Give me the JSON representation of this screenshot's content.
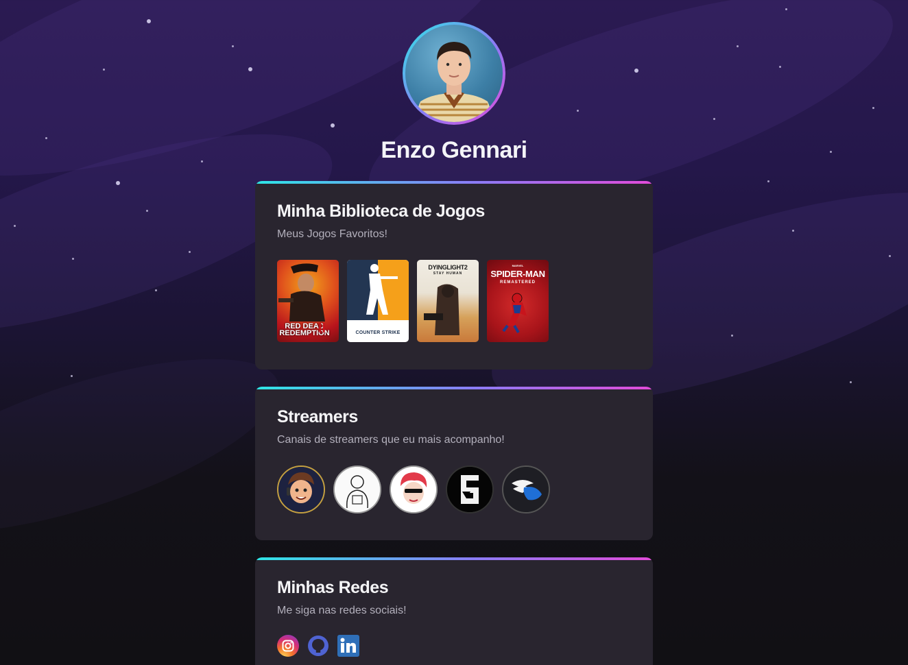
{
  "profile": {
    "name": "Enzo Gennari"
  },
  "games_section": {
    "title": "Minha Biblioteca de Jogos",
    "subtitle": "Meus Jogos Favoritos!",
    "games": [
      {
        "name": "RED DEAD REDEMPTION II",
        "cover_text": "RED DEAD\nREDEMPTION",
        "mark": "II"
      },
      {
        "name": "COUNTER STRIKE",
        "cover_text_a": "COUNTER",
        "cover_text_b": "STRIKE"
      },
      {
        "name": "DYING LIGHT 2",
        "cover_text": "DYINGLIGHT2",
        "cover_sub": "STAY HUMAN"
      },
      {
        "name": "SPIDER-MAN REMASTERED",
        "cover_text_small": "MARVEL",
        "cover_text": "SPIDER-MAN",
        "cover_sub": "REMASTERED"
      }
    ]
  },
  "streamers_section": {
    "title": "Streamers",
    "subtitle": "Canais de streamers que eu mais acompanho!",
    "streamers": [
      {
        "icon": "streamer-avatar-cartoon-boy-icon"
      },
      {
        "icon": "streamer-avatar-sketch-icon"
      },
      {
        "icon": "streamer-avatar-red-hair-icon"
      },
      {
        "icon": "streamer-avatar-rainbow-six-icon"
      },
      {
        "icon": "streamer-avatar-wing-icon"
      }
    ]
  },
  "social_section": {
    "title": "Minhas Redes",
    "subtitle": "Me siga nas redes sociais!",
    "links": [
      {
        "icon": "instagram-icon",
        "color": "#e1306c"
      },
      {
        "icon": "github-icon",
        "color": "#5a6bd8"
      },
      {
        "icon": "linkedin-icon",
        "color": "#2f6fb8"
      }
    ]
  },
  "colors": {
    "accent_start": "#2ee6e6",
    "accent_mid": "#8b7cf6",
    "accent_end": "#e24bd9",
    "card_bg": "#29252f"
  }
}
